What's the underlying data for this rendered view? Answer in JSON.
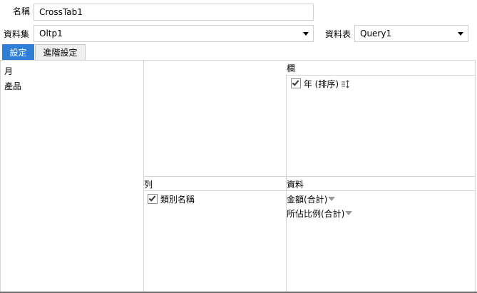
{
  "form": {
    "name_label": "名稱",
    "name_value": "CrossTab1",
    "dataset_label": "資料集",
    "dataset_value": "Oltp1",
    "table_label": "資料表",
    "table_value": "Query1"
  },
  "tabs": [
    {
      "label": "設定",
      "active": true
    },
    {
      "label": "進階設定",
      "active": false
    }
  ],
  "fields_list": {
    "items": [
      "月",
      "產品"
    ]
  },
  "columns_area": {
    "title": "欄",
    "items": [
      {
        "label": "年 (排序)",
        "checked": true
      }
    ]
  },
  "rows_area": {
    "title": "列",
    "items": [
      {
        "label": "類別名稱",
        "checked": true
      }
    ]
  },
  "data_area": {
    "title": "資料",
    "items": [
      "金額(合計)",
      "所佔比例(合計)"
    ]
  },
  "icons": {
    "sort": "sort-icon",
    "dropdown": "triangle-down-icon",
    "check": "checkbox-icon"
  },
  "colors": {
    "active_tab": "#2f7fd6",
    "border": "#d4d4d4"
  }
}
